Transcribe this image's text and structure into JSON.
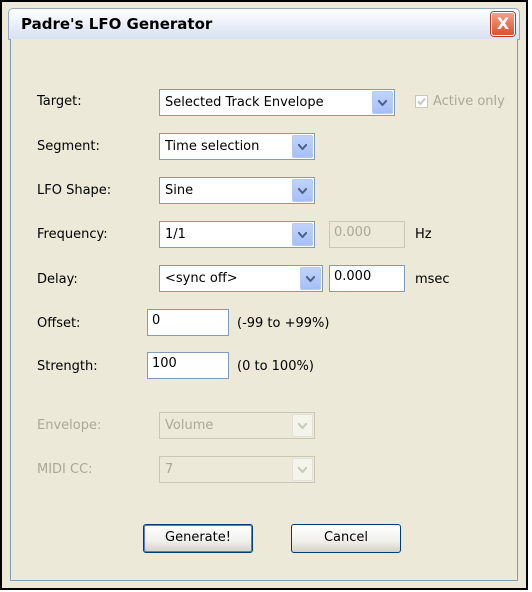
{
  "window": {
    "title": "Padre's LFO Generator",
    "close_glyph": "X"
  },
  "target": {
    "label": "Target:",
    "value": "Selected Track Envelope"
  },
  "active_only": {
    "label": "Active only",
    "checked": true,
    "enabled": false
  },
  "segment": {
    "label": "Segment:",
    "value": "Time selection"
  },
  "lfo_shape": {
    "label": "LFO Shape:",
    "value": "Sine"
  },
  "frequency": {
    "label": "Frequency:",
    "value": "1/1",
    "hz_value": "0.000",
    "hz_unit": "Hz"
  },
  "delay": {
    "label": "Delay:",
    "value": "<sync off>",
    "ms_value": "0.000",
    "ms_unit": "msec"
  },
  "offset": {
    "label": "Offset:",
    "value": "0",
    "range": "(-99 to +99%)"
  },
  "strength": {
    "label": "Strength:",
    "value": "100",
    "range": "(0 to 100%)"
  },
  "envelope": {
    "label": "Envelope:",
    "value": "Volume",
    "enabled": false
  },
  "midi_cc": {
    "label": "MIDI CC:",
    "value": "7",
    "enabled": false
  },
  "buttons": {
    "generate": "Generate!",
    "cancel": "Cancel"
  },
  "icons": {
    "close": "close-icon",
    "dropdown": "chevron-down-icon",
    "check": "checkmark-icon"
  }
}
